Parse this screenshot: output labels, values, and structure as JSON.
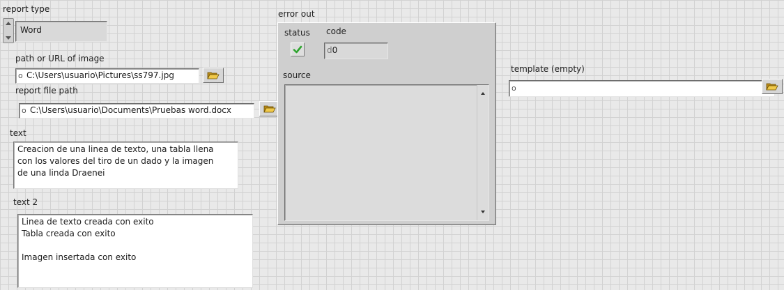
{
  "report_type": {
    "label": "report type",
    "value": "Word"
  },
  "image_path": {
    "label": "path or URL of image",
    "value": "C:\\Users\\usuario\\Pictures\\ss797.jpg"
  },
  "report_file_path": {
    "label": "report file path",
    "value": "C:\\Users\\usuario\\Documents\\Pruebas word.docx"
  },
  "text": {
    "label": "text",
    "value": "Creacion de una linea de texto, una tabla llena\ncon los valores del tiro de un dado y la imagen\nde una linda Draenei"
  },
  "text2": {
    "label": "text 2",
    "value": "Linea de texto creada con exito\nTabla creada con exito\n\nImagen insertada con exito"
  },
  "error_out": {
    "label": "error out",
    "status_label": "status",
    "code_label": "code",
    "code_prefix": "d",
    "code_value": "0",
    "source_label": "source",
    "source_value": "",
    "status_ok": true
  },
  "template": {
    "label": "template (empty)",
    "value": ""
  },
  "colors": {
    "status_check": "#2fa52f"
  },
  "icons": {
    "path": "path-icon",
    "browse": "folder-open-icon",
    "spinner": "ring-spinner-icon",
    "status": "checkmark-icon"
  }
}
